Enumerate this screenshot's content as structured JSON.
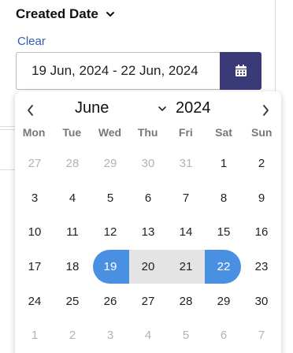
{
  "filter": {
    "title": "Created Date",
    "clear_label": "Clear",
    "date_value": "19 Jun, 2024 - 22 Jun, 2024"
  },
  "calendar": {
    "month": "June",
    "year": "2024",
    "weekdays": [
      "Mon",
      "Tue",
      "Wed",
      "Thu",
      "Fri",
      "Sat",
      "Sun"
    ],
    "weeks": [
      [
        {
          "d": "27",
          "m": true
        },
        {
          "d": "28",
          "m": true
        },
        {
          "d": "29",
          "m": true
        },
        {
          "d": "30",
          "m": true
        },
        {
          "d": "31",
          "m": true
        },
        {
          "d": "1"
        },
        {
          "d": "2"
        }
      ],
      [
        {
          "d": "3"
        },
        {
          "d": "4"
        },
        {
          "d": "5"
        },
        {
          "d": "6"
        },
        {
          "d": "7"
        },
        {
          "d": "8"
        },
        {
          "d": "9"
        }
      ],
      [
        {
          "d": "10"
        },
        {
          "d": "11"
        },
        {
          "d": "12"
        },
        {
          "d": "13"
        },
        {
          "d": "14"
        },
        {
          "d": "15"
        },
        {
          "d": "16"
        }
      ],
      [
        {
          "d": "17"
        },
        {
          "d": "18"
        },
        {
          "d": "19",
          "s": "start"
        },
        {
          "d": "20",
          "s": "mid"
        },
        {
          "d": "21",
          "s": "mid"
        },
        {
          "d": "22",
          "s": "end"
        },
        {
          "d": "23"
        }
      ],
      [
        {
          "d": "24"
        },
        {
          "d": "25"
        },
        {
          "d": "26"
        },
        {
          "d": "27"
        },
        {
          "d": "28"
        },
        {
          "d": "29"
        },
        {
          "d": "30"
        }
      ],
      [
        {
          "d": "1",
          "m": true
        },
        {
          "d": "2",
          "m": true
        },
        {
          "d": "3",
          "m": true
        },
        {
          "d": "4",
          "m": true
        },
        {
          "d": "5",
          "m": true
        },
        {
          "d": "6",
          "m": true
        },
        {
          "d": "7",
          "m": true
        }
      ]
    ]
  },
  "icons": {
    "expand": "chevron-down-icon",
    "calendar": "calendar-icon",
    "prev": "chevron-left-icon",
    "next": "chevron-right-icon"
  },
  "colors": {
    "accent_button": "#3b3a78",
    "selected_day": "#4a90e2",
    "range_fill": "#e4e4e4",
    "link": "#2f5db8"
  }
}
